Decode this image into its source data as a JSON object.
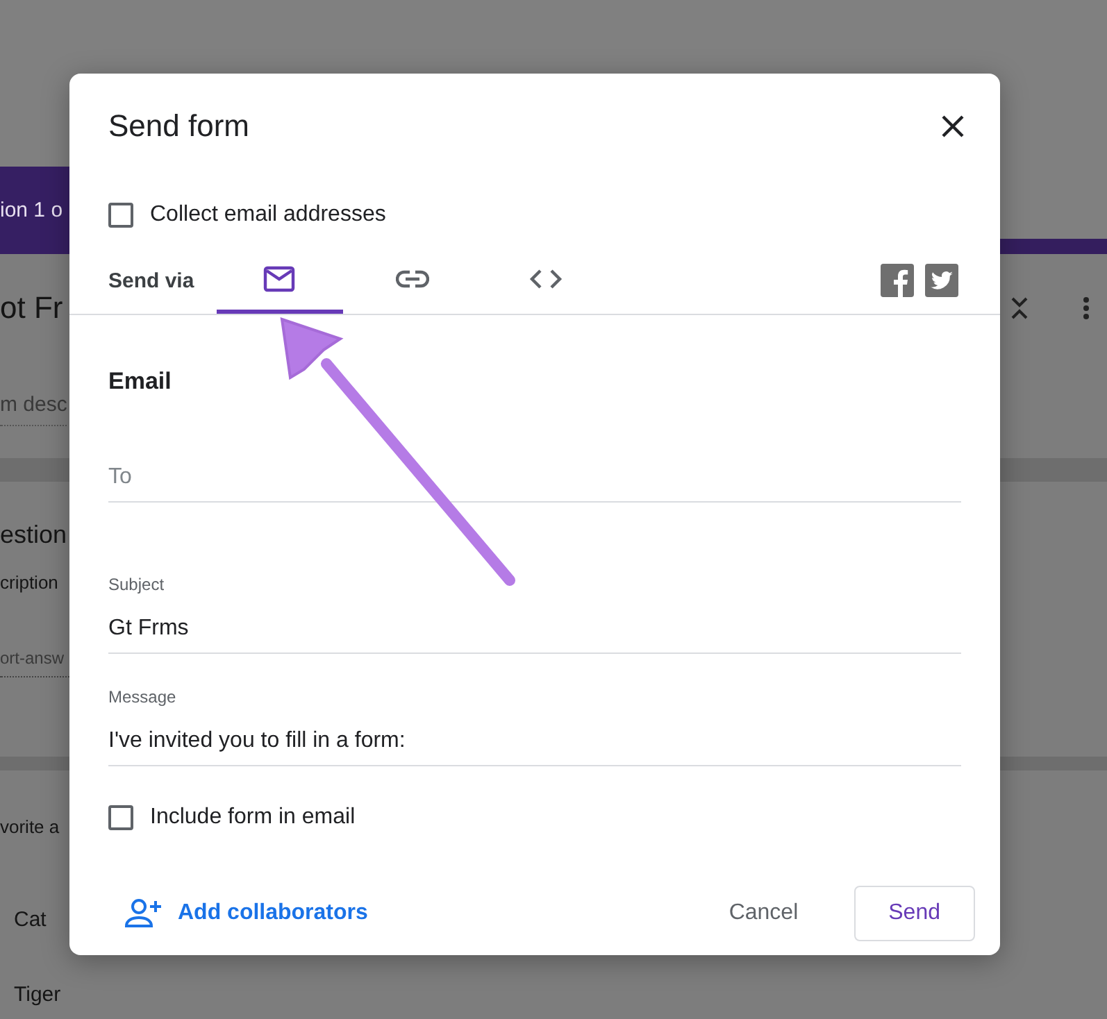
{
  "background": {
    "section_tab": "ion 1 o",
    "form_title": "ot Fr",
    "form_description": "m desc",
    "question_title": "estion",
    "question_description": "cription",
    "answer_hint": "ort-answ",
    "question_2_title": "vorite a",
    "options": [
      "Cat",
      "Tiger"
    ]
  },
  "dialog": {
    "title": "Send form",
    "collect_emails": {
      "label": "Collect email addresses",
      "checked": false
    },
    "send_via": {
      "label": "Send via",
      "tabs": [
        {
          "kind": "email",
          "selected": true
        },
        {
          "kind": "link",
          "selected": false
        },
        {
          "kind": "embed",
          "selected": false
        }
      ],
      "share": [
        {
          "kind": "facebook"
        },
        {
          "kind": "twitter"
        }
      ]
    },
    "section_title": "Email",
    "to": {
      "placeholder": "To"
    },
    "subject": {
      "label": "Subject",
      "value": "Gt Frms"
    },
    "message": {
      "label": "Message",
      "value": "I've invited you to fill in a form:"
    },
    "include_form": {
      "label": "Include form in email",
      "checked": false
    },
    "add_collaborators": "Add collaborators",
    "buttons": [
      {
        "kind": "cancel",
        "label": "Cancel"
      },
      {
        "kind": "send",
        "label": "Send"
      }
    ]
  },
  "annotation": {
    "kind": "arrow"
  }
}
